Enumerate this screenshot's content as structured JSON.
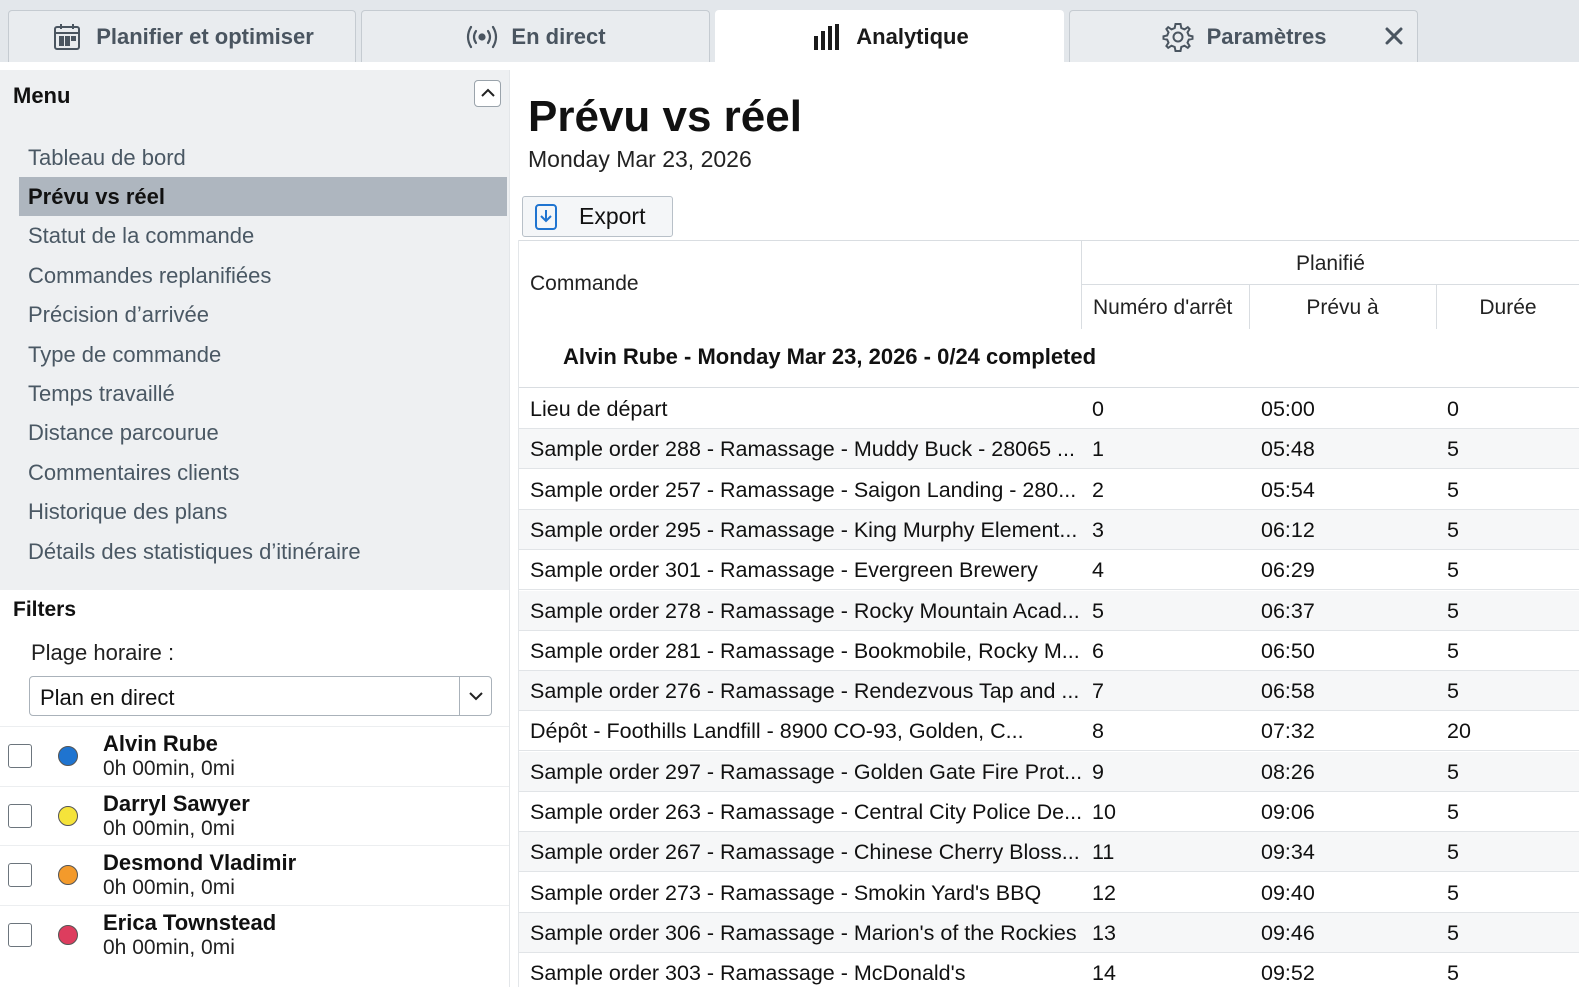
{
  "tabs": [
    {
      "label": "Planifier et optimiser",
      "icon": "calendar-icon"
    },
    {
      "label": "En direct",
      "icon": "broadcast-icon"
    },
    {
      "label": "Analytique",
      "icon": "bar-chart-icon"
    },
    {
      "label": "Paramètres",
      "icon": "gear-icon"
    }
  ],
  "sidebar": {
    "menu_title": "Menu",
    "menu_items": [
      {
        "label": "Tableau de bord"
      },
      {
        "label": "Prévu vs réel"
      },
      {
        "label": "Statut de la commande"
      },
      {
        "label": "Commandes replanifiées"
      },
      {
        "label": "Précision d’arrivée"
      },
      {
        "label": "Type de commande"
      },
      {
        "label": "Temps travaillé"
      },
      {
        "label": "Distance parcourue"
      },
      {
        "label": "Commentaires clients"
      },
      {
        "label": "Historique des plans"
      },
      {
        "label": "Détails des statistiques d’itinéraire"
      }
    ],
    "active_menu_index": 1,
    "filters_title": "Filters",
    "time_range_label": "Plage horaire :",
    "time_range_value": "Plan en direct",
    "drivers": [
      {
        "name": "Alvin Rube",
        "stats": "0h 00min, 0mi",
        "color": "#1f74d0"
      },
      {
        "name": "Darryl Sawyer",
        "stats": "0h 00min, 0mi",
        "color": "#f5e33a"
      },
      {
        "name": "Desmond Vladimir",
        "stats": "0h 00min, 0mi",
        "color": "#f39a2b"
      },
      {
        "name": "Erica Townstead",
        "stats": "0h 00min, 0mi",
        "color": "#dd3d5e"
      }
    ]
  },
  "main": {
    "title": "Prévu vs réel",
    "date": "Monday Mar 23, 2026",
    "export_label": "Export",
    "table": {
      "col_commande": "Commande",
      "group_planifie": "Planifié",
      "col_numero": "Numéro d'arrêt",
      "col_prevu": "Prévu à",
      "col_duree": "Durée",
      "group_label": "Alvin Rube - Monday Mar 23, 2026 - 0/24 completed",
      "rows": [
        {
          "commande": "Lieu de départ",
          "numero": "0",
          "prevu": "05:00",
          "duree": "0"
        },
        {
          "commande": "Sample order 288 - Ramassage - Muddy Buck - 28065 ...",
          "numero": "1",
          "prevu": "05:48",
          "duree": "5"
        },
        {
          "commande": "Sample order 257 - Ramassage - Saigon Landing - 280...",
          "numero": "2",
          "prevu": "05:54",
          "duree": "5"
        },
        {
          "commande": "Sample order 295 - Ramassage - King Murphy Element...",
          "numero": "3",
          "prevu": "06:12",
          "duree": "5"
        },
        {
          "commande": "Sample order 301 - Ramassage - Evergreen Brewery",
          "numero": "4",
          "prevu": "06:29",
          "duree": "5"
        },
        {
          "commande": "Sample order 278 - Ramassage - Rocky Mountain Acad...",
          "numero": "5",
          "prevu": "06:37",
          "duree": "5"
        },
        {
          "commande": "Sample order 281 - Ramassage - Bookmobile, Rocky M...",
          "numero": "6",
          "prevu": "06:50",
          "duree": "5"
        },
        {
          "commande": "Sample order 276 - Ramassage - Rendezvous Tap and ...",
          "numero": "7",
          "prevu": "06:58",
          "duree": "5"
        },
        {
          "commande": "Dépôt - Foothills Landfill - 8900 CO-93, Golden, C...",
          "numero": "8",
          "prevu": "07:32",
          "duree": "20"
        },
        {
          "commande": "Sample order 297 - Ramassage - Golden Gate Fire Prot...",
          "numero": "9",
          "prevu": "08:26",
          "duree": "5"
        },
        {
          "commande": "Sample order 263 - Ramassage - Central City Police De...",
          "numero": "10",
          "prevu": "09:06",
          "duree": "5"
        },
        {
          "commande": "Sample order 267 - Ramassage - Chinese Cherry Bloss...",
          "numero": "11",
          "prevu": "09:34",
          "duree": "5"
        },
        {
          "commande": "Sample order 273 - Ramassage - Smokin Yard's BBQ",
          "numero": "12",
          "prevu": "09:40",
          "duree": "5"
        },
        {
          "commande": "Sample order 306 - Ramassage - Marion's of the Rockies",
          "numero": "13",
          "prevu": "09:46",
          "duree": "5"
        },
        {
          "commande": "Sample order 303 - Ramassage - McDonald's",
          "numero": "14",
          "prevu": "09:52",
          "duree": "5"
        }
      ]
    }
  }
}
